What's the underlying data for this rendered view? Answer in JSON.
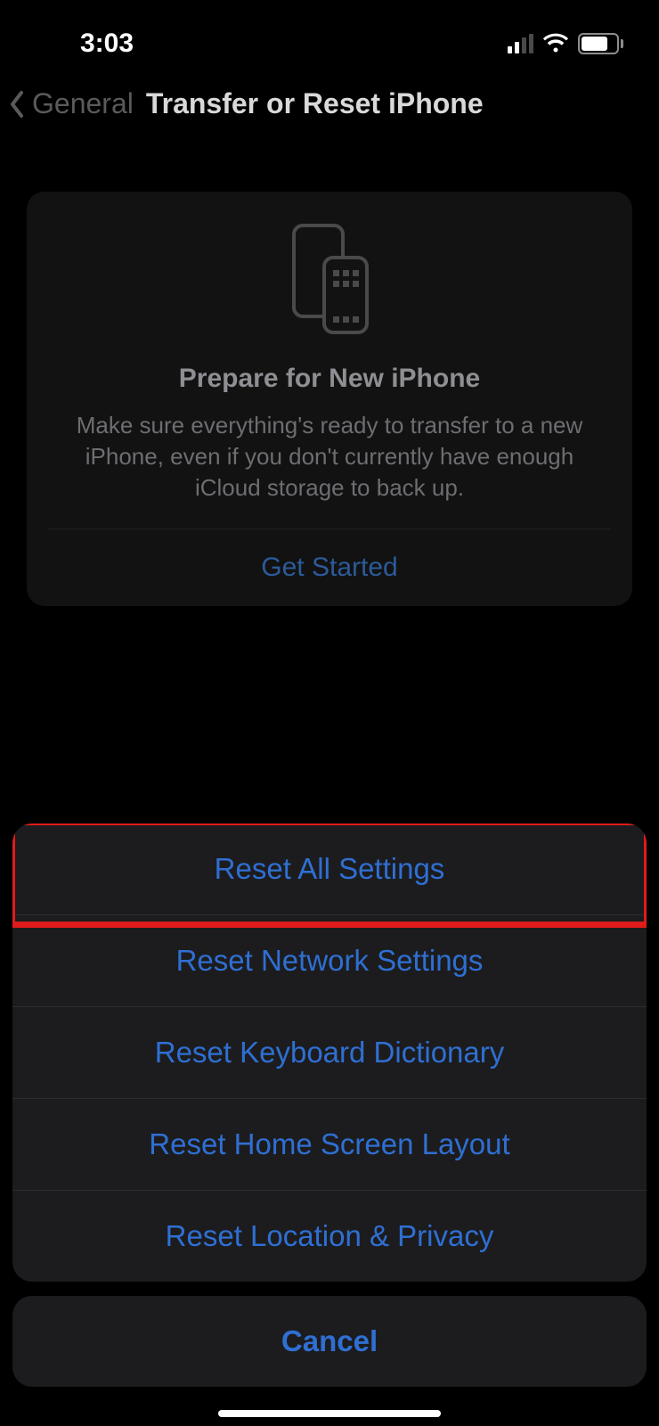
{
  "status": {
    "time": "3:03"
  },
  "nav": {
    "back_label": "General",
    "title": "Transfer or Reset iPhone"
  },
  "prepare_card": {
    "title": "Prepare for New iPhone",
    "description": "Make sure everything's ready to transfer to a new iPhone, even if you don't currently have enough iCloud storage to back up.",
    "action_label": "Get Started"
  },
  "action_sheet": {
    "options": [
      "Reset All Settings",
      "Reset Network Settings",
      "Reset Keyboard Dictionary",
      "Reset Home Screen Layout",
      "Reset Location & Privacy"
    ],
    "cancel_label": "Cancel",
    "highlighted_index": 0
  },
  "colors": {
    "link": "#2f6fd3",
    "highlight_border": "#e11b1b"
  }
}
